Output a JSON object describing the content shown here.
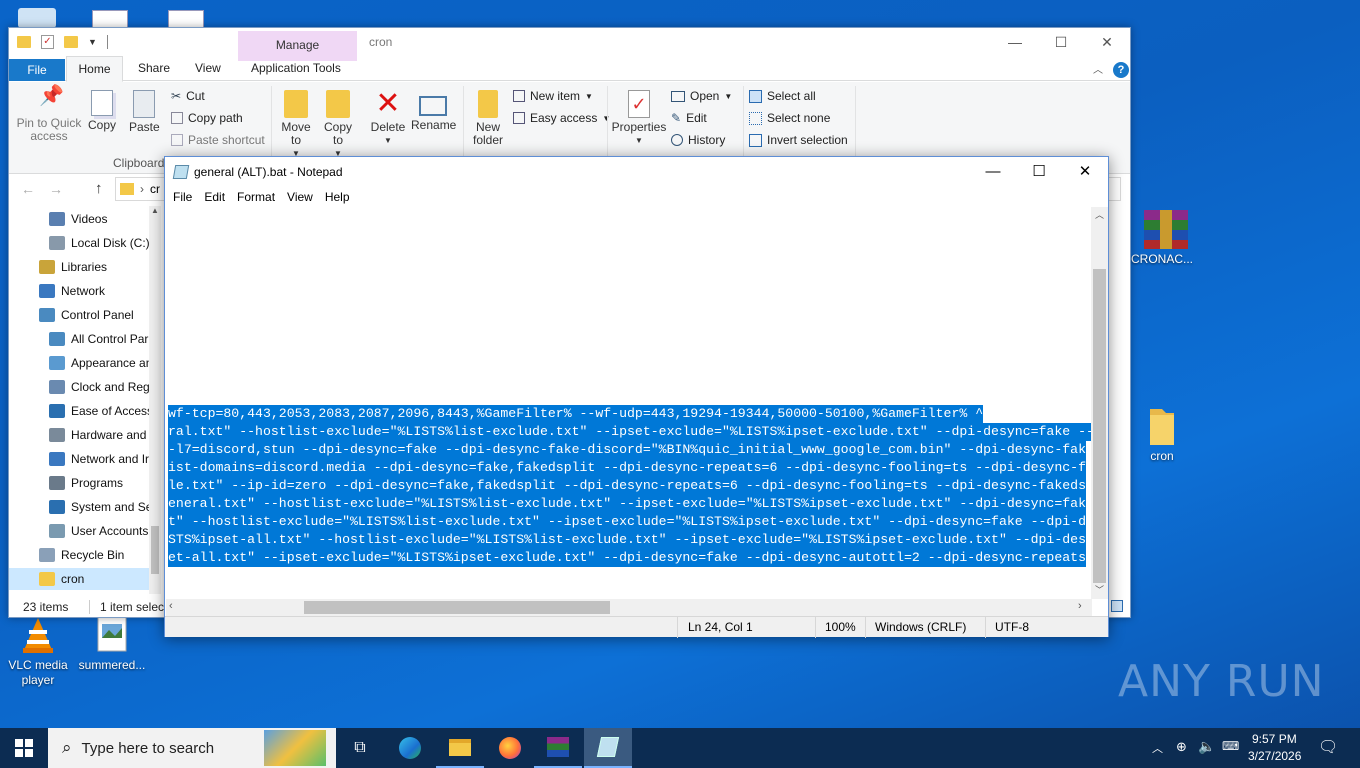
{
  "desktop": {
    "icons": [
      {
        "label": "CRONAC...",
        "icon": "winrar-icon"
      },
      {
        "label": "cron",
        "icon": "folder-icon"
      },
      {
        "label": "VLC media player",
        "icon": "vlc-icon"
      },
      {
        "label": "summered...",
        "icon": "image-file-icon"
      }
    ],
    "watermark": "ANY RUN"
  },
  "explorer": {
    "title": "cron",
    "manage_tab": "Manage",
    "tabs": [
      "File",
      "Home",
      "Share",
      "View",
      "Application Tools"
    ],
    "ribbon": {
      "pin": "Pin to Quick access",
      "copy": "Copy",
      "paste": "Paste",
      "cut": "Cut",
      "copy_path": "Copy path",
      "paste_shortcut": "Paste shortcut",
      "clipboard_group": "Clipboard",
      "move_to": "Move to",
      "copy_to": "Copy to",
      "delete": "Delete",
      "rename": "Rename",
      "new_folder": "New folder",
      "new_item": "New item",
      "easy_access": "Easy access",
      "properties": "Properties",
      "open": "Open",
      "edit": "Edit",
      "history": "History",
      "select_all": "Select all",
      "select_none": "Select none",
      "invert_selection": "Invert selection"
    },
    "address_partial": "cr",
    "nav_items": [
      {
        "label": "Videos",
        "icon": "videos-icon"
      },
      {
        "label": "Local Disk (C:)",
        "icon": "disk-icon"
      },
      {
        "label": "Libraries",
        "icon": "libraries-icon"
      },
      {
        "label": "Network",
        "icon": "network-icon"
      },
      {
        "label": "Control Panel",
        "icon": "control-panel-icon"
      },
      {
        "label": "All Control Par",
        "icon": "control-panel-icon"
      },
      {
        "label": "Appearance an",
        "icon": "appearance-icon"
      },
      {
        "label": "Clock and Regi",
        "icon": "clock-icon"
      },
      {
        "label": "Ease of Access",
        "icon": "ease-access-icon"
      },
      {
        "label": "Hardware and",
        "icon": "hardware-icon"
      },
      {
        "label": "Network and Ir",
        "icon": "network-internet-icon"
      },
      {
        "label": "Programs",
        "icon": "programs-icon"
      },
      {
        "label": "System and Sec",
        "icon": "shield-icon"
      },
      {
        "label": "User Accounts",
        "icon": "users-icon"
      },
      {
        "label": "Recycle Bin",
        "icon": "recycle-bin-icon"
      },
      {
        "label": "cron",
        "icon": "folder-icon"
      }
    ],
    "status": {
      "count": "23 items",
      "selected": "1 item selected"
    }
  },
  "notepad": {
    "title": "general (ALT).bat - Notepad",
    "menu": [
      "File",
      "Edit",
      "Format",
      "View",
      "Help"
    ],
    "lines": [
      "wf-tcp=80,443,2053,2083,2087,2096,8443,%GameFilter% --wf-udp=443,19294-19344,50000-50100,%GameFilter% ^",
      "ral.txt\" --hostlist-exclude=\"%LISTS%list-exclude.txt\" --ipset-exclude=\"%LISTS%ipset-exclude.txt\" --dpi-desync=fake --",
      "-l7=discord,stun --dpi-desync=fake --dpi-desync-fake-discord=\"%BIN%quic_initial_www_google_com.bin\" --dpi-desync-fak",
      "ist-domains=discord.media --dpi-desync=fake,fakedsplit --dpi-desync-repeats=6 --dpi-desync-fooling=ts --dpi-desync-f",
      "le.txt\" --ip-id=zero --dpi-desync=fake,fakedsplit --dpi-desync-repeats=6 --dpi-desync-fooling=ts --dpi-desync-fakeds",
      "eneral.txt\" --hostlist-exclude=\"%LISTS%list-exclude.txt\" --ipset-exclude=\"%LISTS%ipset-exclude.txt\" --dpi-desync=fak",
      "t\" --hostlist-exclude=\"%LISTS%list-exclude.txt\" --ipset-exclude=\"%LISTS%ipset-exclude.txt\" --dpi-desync=fake --dpi-d",
      "STS%ipset-all.txt\" --hostlist-exclude=\"%LISTS%list-exclude.txt\" --ipset-exclude=\"%LISTS%ipset-exclude.txt\" --dpi-des",
      "et-all.txt\" --ipset-exclude=\"%LISTS%ipset-exclude.txt\" --dpi-desync=fake --dpi-desync-autottl=2 --dpi-desync-repeats"
    ],
    "status": {
      "position": "Ln 24, Col 1",
      "zoom": "100%",
      "eol": "Windows (CRLF)",
      "encoding": "UTF-8"
    }
  },
  "taskbar": {
    "search_placeholder": "Type here to search",
    "time": "9:57 PM",
    "date": "3/27/2026"
  },
  "colors": {
    "selection": "#0078d7",
    "taskbar": "#0c2c52",
    "file_tab": "#1979ca"
  }
}
